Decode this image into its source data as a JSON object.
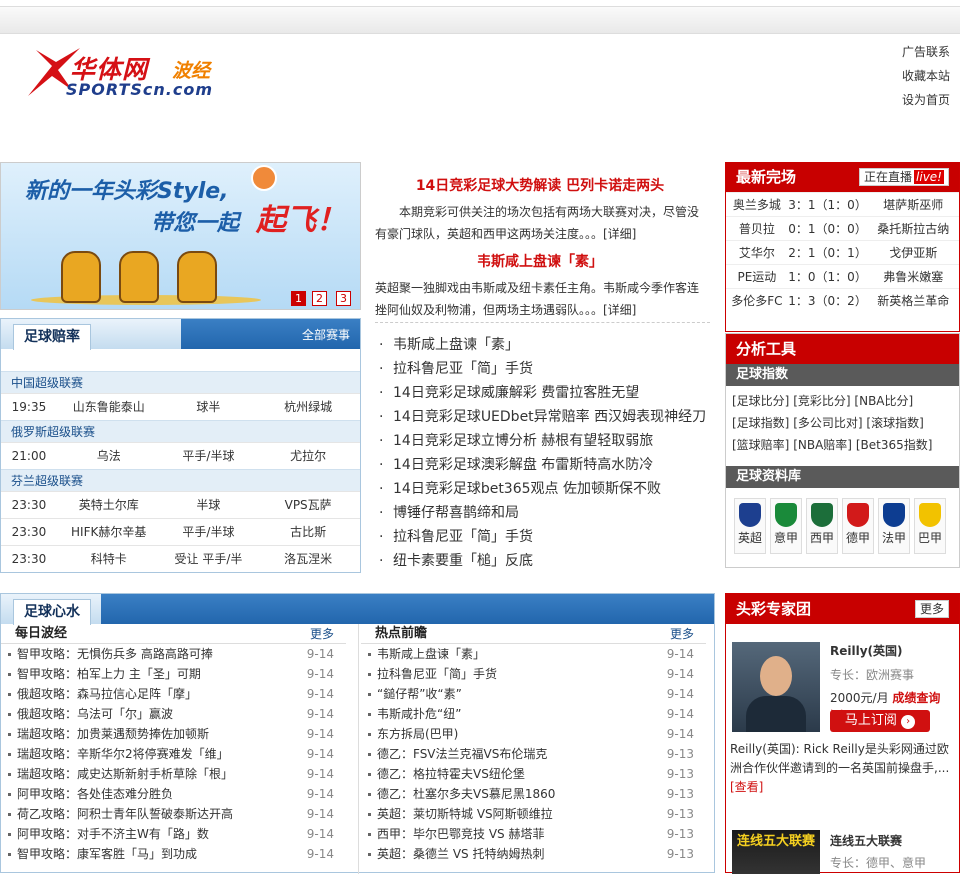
{
  "header": {
    "logo_cn": "华体网",
    "logo_bo": "波经",
    "logo_en": "SPORTScn.com",
    "links": [
      "广告联系",
      "收藏本站",
      "设为首页"
    ]
  },
  "banner": {
    "line1": "新的一年头彩Style,",
    "line2": "带您一起",
    "line3": "起飞！",
    "pages": [
      "1",
      "2",
      "3"
    ]
  },
  "odds": {
    "tab": "足球赔率",
    "more": "全部赛事",
    "leagues": [
      {
        "name": "中国超级联赛",
        "matches": [
          {
            "time": "19:35",
            "home": "山东鲁能泰山",
            "odds": "球半",
            "away": "杭州绿城"
          }
        ]
      },
      {
        "name": "俄罗斯超级联赛",
        "matches": [
          {
            "time": "21:00",
            "home": "乌法",
            "odds": "平手/半球",
            "away": "尤拉尔"
          }
        ]
      },
      {
        "name": "芬兰超级联赛",
        "matches": [
          {
            "time": "23:30",
            "home": "英特土尔库",
            "odds": "半球",
            "away": "VPS瓦萨"
          },
          {
            "time": "23:30",
            "home": "HIFK赫尔辛基",
            "odds": "平手/半球",
            "away": "古比斯"
          },
          {
            "time": "23:30",
            "home": "科特卡",
            "odds": "受让 平手/半",
            "away": "洛瓦涅米"
          }
        ]
      }
    ]
  },
  "center": {
    "h1": "14日竞彩足球大势解读 巴列卡诺走两头",
    "p1": "本期竞彩可供关注的场次包括有两场大联赛对决，尽管没有豪门球队，英超和西甲这两场关注度。。。[详细]",
    "h2": "韦斯咸上盘谏「素」",
    "p2": "英超聚一独脚戏由韦斯咸及纽卡素任主角。韦斯咸今季作客连挫阿仙奴及利物浦，但两场主场遇弱队。。。[详细]",
    "news": [
      "韦斯咸上盘谏「素」",
      "拉科鲁尼亚「简」手货",
      "14日竞彩足球威廉解彩 费雷拉客胜无望",
      "14日竞彩足球UEDbet异常赔率 西汉姆表现神经刀",
      "14日竞彩足球立博分析 赫根有望轻取弱旅",
      "14日竞彩足球澳彩解盘 布雷斯特高水防冷",
      "14日竞彩足球bet365观点 佐加顿斯保不败",
      "博锤仔帮喜鹊缔和局",
      "拉科鲁尼亚「简」手货",
      "纽卡素要重「槌」反底"
    ]
  },
  "results": {
    "title": "最新完场",
    "live_btn": "正在直播",
    "live_tag": "live!",
    "rows": [
      {
        "home": "奥兰多城",
        "score": "3：1（1：0）",
        "away": "堪萨斯巫师"
      },
      {
        "home": "普贝拉",
        "score": "0：1（0：0）",
        "away": "桑托斯拉古纳"
      },
      {
        "home": "艾华尔",
        "score": "2：1（0：1）",
        "away": "戈伊亚斯"
      },
      {
        "home": "PE运动",
        "score": "1：0（1：0）",
        "away": "弗鲁米嫩塞"
      },
      {
        "home": "多伦多FC",
        "score": "1：3（0：2）",
        "away": "新英格兰革命"
      }
    ]
  },
  "tools": {
    "title": "分析工具",
    "index_head": "足球指数",
    "links": [
      "[足球比分]",
      "[竞彩比分]",
      "[NBA比分]",
      "[足球指数]",
      "[多公司比对]",
      "[滚球指数]",
      "[篮球赔率]",
      "[NBA赔率]",
      "[Bet365指数]"
    ],
    "db_head": "足球资料库",
    "leagues": [
      {
        "name": "英超",
        "color": "#1d3f8f"
      },
      {
        "name": "意甲",
        "color": "#1a8a3a"
      },
      {
        "name": "西甲",
        "color": "#1c6e3a"
      },
      {
        "name": "德甲",
        "color": "#d21a1a"
      },
      {
        "name": "法甲",
        "color": "#0d3d91"
      },
      {
        "name": "巴甲",
        "color": "#f2c200"
      }
    ]
  },
  "xinshui": {
    "tab": "足球心水",
    "left_title": "每日波经",
    "right_title": "热点前瞻",
    "more": "更多",
    "left": [
      {
        "t": "智甲攻略：无惧伤兵多 高路高路可捧",
        "d": "9-14"
      },
      {
        "t": "智甲攻略：柏军上力 主「圣」可期",
        "d": "9-14"
      },
      {
        "t": "俄超攻略：森马拉信心足阵「摩」",
        "d": "9-14"
      },
      {
        "t": "俄超攻略：乌法可「尔」赢波",
        "d": "9-14"
      },
      {
        "t": "瑞超攻略：加贵莱遇颓势捧佐加顿斯",
        "d": "9-14"
      },
      {
        "t": "瑞超攻略：辛斯华尔2将停赛难发「维」",
        "d": "9-14"
      },
      {
        "t": "瑞超攻略：咸史达斯新射手析草除「根」",
        "d": "9-14"
      },
      {
        "t": "阿甲攻略：各处佳态难分胜负",
        "d": "9-14"
      },
      {
        "t": "荷乙攻略：阿积士青年队誓破泰斯达开高",
        "d": "9-14"
      },
      {
        "t": "阿甲攻略：对手不济主W有「路」数",
        "d": "9-14"
      },
      {
        "t": "智甲攻略：康军客胜「马」到功成",
        "d": "9-14"
      }
    ],
    "right": [
      {
        "t": "韦斯咸上盘谏「素」",
        "d": "9-14"
      },
      {
        "t": "拉科鲁尼亚「简」手货",
        "d": "9-14"
      },
      {
        "t": "“鎚仔帮”收“素”",
        "d": "9-14"
      },
      {
        "t": "韦斯咸扑危“纽”",
        "d": "9-14"
      },
      {
        "t": "东方拆局(巴甲)",
        "d": "9-14"
      },
      {
        "t": "德乙：FSV法兰克福VS布伦瑞克",
        "d": "9-13"
      },
      {
        "t": "德乙：格拉特霍夫VS纽伦堡",
        "d": "9-13"
      },
      {
        "t": "德乙：杜塞尔多夫VS慕尼黑1860",
        "d": "9-13"
      },
      {
        "t": "英超：莱切斯特城 VS阿斯顿维拉",
        "d": "9-13"
      },
      {
        "t": "西甲：毕尔巴鄂竞技 VS 赫塔菲",
        "d": "9-13"
      },
      {
        "t": "英超：桑德兰 VS 托特纳姆热刺",
        "d": "9-13"
      }
    ]
  },
  "experts": {
    "title": "头彩专家团",
    "more": "更多",
    "name": "Reilly(英国)",
    "spec": "专长：欧洲赛事",
    "price": "2000元/月",
    "query": "成绩查询>>",
    "subscribe": "马上订阅",
    "bio": "Reilly(英国): Rick Reilly是头彩网通过欧洲合作伙伴邀请到的一名英国前操盘手,...",
    "view": "[查看]",
    "second_name": "连线五大联赛",
    "second_spec": "专长：德甲、意甲",
    "second_img": "连线五大联赛"
  }
}
